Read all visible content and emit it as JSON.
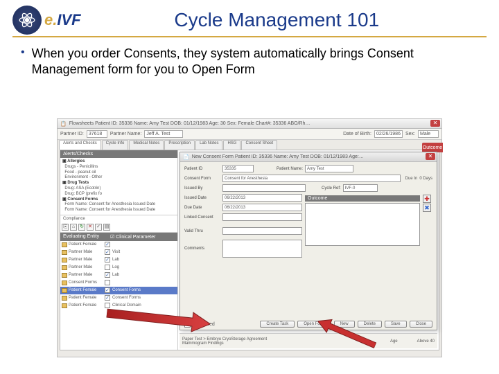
{
  "slide": {
    "title": "Cycle Management 101",
    "logo_text_yellow": "e.",
    "logo_text_blue": "IVF",
    "bullet": "When you order Consents, they system automatically brings Consent Management form for you to Open Form"
  },
  "app": {
    "flowsheet_title": "Flowsheets   Patient ID: 35336   Name: Amy Test   DOB: 01/12/1983   Age: 30   Sex: Female   Chart#: 35336   ABO/Rh…",
    "partner_id_label": "Partner ID:",
    "partner_id": "37618",
    "partner_name_label": "Partner Name:",
    "partner_name": "Jeff A. Test",
    "dob_label": "Date of Birth:",
    "dob": "02/26/1986",
    "sex_label": "Sex:",
    "sex": "Male",
    "tabs": [
      "Alerts and Checks",
      "Cycle Info",
      "Medical Notes",
      "Prescription",
      "Lab Notes",
      "HSG",
      "Consent Sheet"
    ],
    "alerts_header": "Alerts/Checks",
    "alerts": {
      "allergies": "Allergies",
      "a1": "Drugs - Penicillins",
      "a2": "Food - peanut oil",
      "a3": "Environment - Other",
      "drug_tests": "Drug Tests",
      "d1": "Drug: ASA (Ecotrin)",
      "d2": "Drug: BCP (prefix fo",
      "consent_forms": "Consent Forms",
      "c1": "Form Name: Consent for Anesthesia Issued Date",
      "c2": "Form Name: Consent for Anesthesia Issued Date"
    },
    "compliance": "Compliance",
    "eval_header_1": "Evaluating Entity",
    "eval_header_2": "Clinical Parameter",
    "eval_rows": [
      {
        "e": "Patient Female",
        "cb": true,
        "p": ""
      },
      {
        "e": "Partner Male",
        "cb": true,
        "p": "Visit"
      },
      {
        "e": "Partner Male",
        "cb": true,
        "p": "Lab"
      },
      {
        "e": "Partner Male",
        "cb": false,
        "p": "Log"
      },
      {
        "e": "Partner Male",
        "cb": true,
        "p": "Lab"
      },
      {
        "e": "Consent Forms",
        "cb": false,
        "p": ""
      },
      {
        "e": "Patient Female",
        "cb": true,
        "p": "Consent Forms",
        "hl": true
      },
      {
        "e": "Patient Female",
        "cb": true,
        "p": "Consent Forms"
      },
      {
        "e": "Patient Female",
        "cb": false,
        "p": "Clinical Domain"
      }
    ],
    "outcome_label": "Outcome"
  },
  "dialog": {
    "title": "New Consent Form    Patient ID: 35336   Name: Amy Test   DOB: 01/12/1983   Age:…",
    "patient_id_label": "Patient ID",
    "patient_id": "35335",
    "patient_name_label": "Patient Name:",
    "patient_name": "Amy Test",
    "consent_form_label": "Consent Form",
    "consent_form": "Consent for Anesthesia",
    "due_in_label": "Due In",
    "due_in": "0 Days",
    "issued_by_label": "Issued By",
    "cycle_ref_label": "Cycle Ref:",
    "cycle_ref": "IVF-0",
    "issued_date_label": "Issued Date",
    "issued_date": "06/22/2013",
    "outcome_header": "Outcome",
    "due_date_label": "Due Date",
    "due_date": "06/22/2013",
    "linked_consent_label": "Linked Consent",
    "valid_thru_label": "Valid Thru",
    "comments_label": "Comments",
    "reviewed_label": "Reviewed",
    "btn_create": "Create Task",
    "btn_open": "Open Form",
    "btn_new": "New",
    "btn_delete": "Delete",
    "btn_save": "Save",
    "btn_close": "Close"
  },
  "footer": {
    "line1": "Paper Test > Embryo CryoStorage Agreement",
    "line2": "Mammogram Findings",
    "age_label": "Age",
    "age_value": "Above 40"
  }
}
